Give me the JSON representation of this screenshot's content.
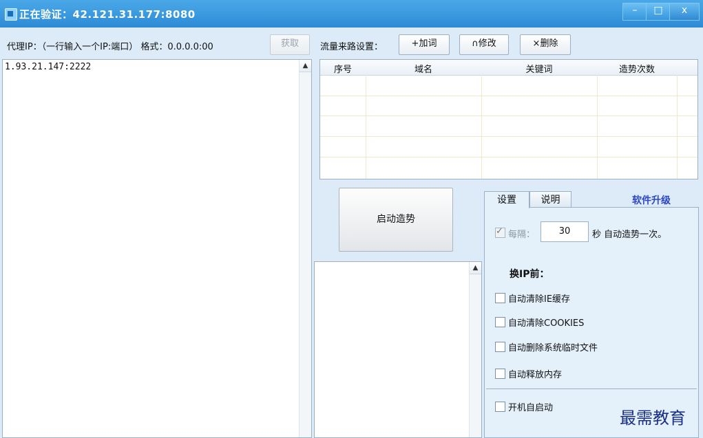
{
  "window": {
    "title": "正在验证：42.121.31.177:8080",
    "minimize": "–",
    "maximize": "□",
    "close": "x"
  },
  "toolbar": {
    "proxy_label": "代理IP：（一行输入一个IP:端口） 格式：0.0.0.0:00",
    "fetch_button": "获取",
    "traffic_label": "流量来路设置：",
    "add_button": "+加词",
    "modify_button": "∩修改",
    "delete_button": "×删除"
  },
  "proxy_list": {
    "text": "1.93.21.147:2222"
  },
  "keyword_table": {
    "columns": [
      "序号",
      "域名",
      "关键词",
      "造势次数"
    ],
    "rows": []
  },
  "start_button": "启动造势",
  "tabs": [
    "设置",
    "说明"
  ],
  "upgrade_link": "软件升级",
  "settings": {
    "interval_label": "每隔：",
    "interval_value": "30",
    "interval_suffix": "秒 自动造势一次。",
    "interval_checked": true,
    "before_ip_title": "换IP前：",
    "options": [
      {
        "label": "自动清除IE缓存",
        "checked": false
      },
      {
        "label": "自动清除COOKIES",
        "checked": false
      },
      {
        "label": "自动删除系统临时文件",
        "checked": false
      },
      {
        "label": "自动释放内存",
        "checked": false
      }
    ],
    "autostart": {
      "label": "开机自启动",
      "checked": false
    }
  },
  "watermark": "最需教育"
}
